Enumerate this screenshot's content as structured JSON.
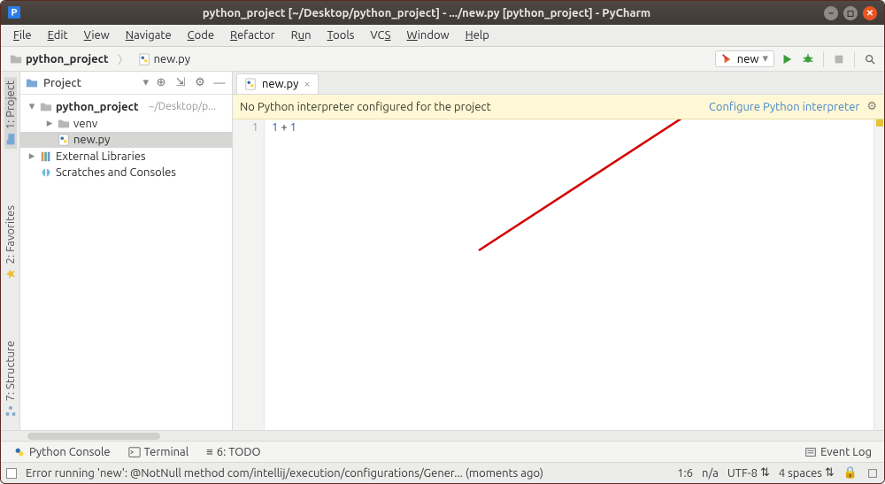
{
  "titlebar": {
    "title": "python_project [~/Desktop/python_project] - .../new.py [python_project] - PyCharm"
  },
  "menubar": {
    "items": [
      "File",
      "Edit",
      "View",
      "Navigate",
      "Code",
      "Refactor",
      "Run",
      "Tools",
      "VCS",
      "Window",
      "Help"
    ]
  },
  "navbar": {
    "breadcrumb": {
      "project": "python_project",
      "file": "new.py"
    },
    "run_config": "new"
  },
  "left_gutter": {
    "project": "1: Project",
    "favorites": "2: Favorites",
    "structure": "7: Structure"
  },
  "project_pane": {
    "header": "Project",
    "tree": {
      "root": {
        "label": "python_project",
        "path": "~/Desktop/p..."
      },
      "venv": "venv",
      "file": "new.py",
      "ext_libs": "External Libraries",
      "scratches": "Scratches and Consoles"
    }
  },
  "editor": {
    "tab": {
      "label": "new.py"
    },
    "warning": {
      "msg": "No Python interpreter configured for the project",
      "link": "Configure Python interpreter"
    },
    "code": {
      "line1_no": "1",
      "line1": "1 + 1"
    }
  },
  "toolsbar": {
    "python_console": "Python Console",
    "terminal": "Terminal",
    "todo": "6: TODO",
    "event_log": "Event Log"
  },
  "statusbar": {
    "msg": "Error running 'new': @NotNull method com/intellij/execution/configurations/Gener... (moments ago)",
    "linecol": "1:6",
    "na": "n/a",
    "encoding": "UTF-8",
    "indent": "4 spaces",
    "lock": "🔒"
  }
}
